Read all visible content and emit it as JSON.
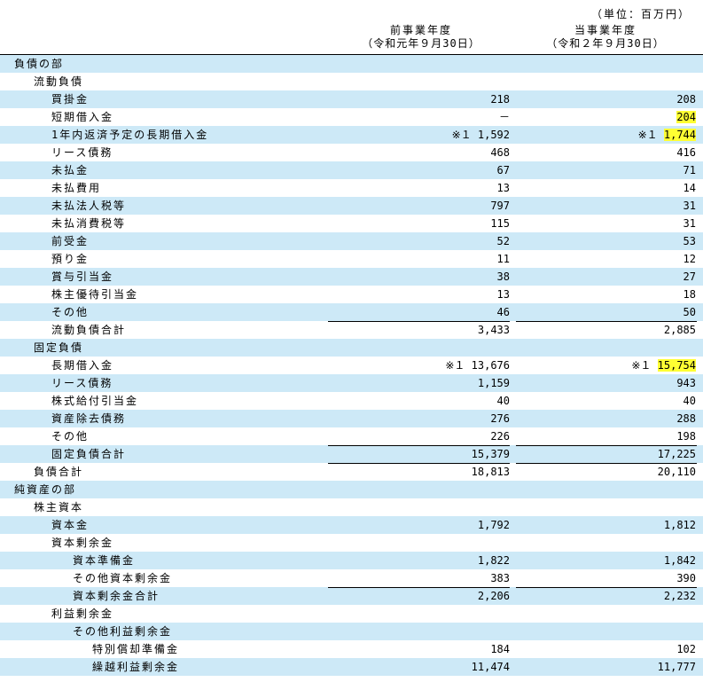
{
  "unit_label": "（単位：百万円）",
  "header": {
    "prev_label": "前事業年度",
    "prev_date": "（令和元年９月30日）",
    "curr_label": "当事業年度",
    "curr_date": "（令和２年９月30日）"
  },
  "rows": [
    {
      "label": "負債の部",
      "indent": 0,
      "prev": "",
      "curr": "",
      "alt": true,
      "line": false
    },
    {
      "label": "流動負債",
      "indent": 1,
      "prev": "",
      "curr": "",
      "alt": false,
      "line": false
    },
    {
      "label": "買掛金",
      "indent": 2,
      "prev": "218",
      "curr": "208",
      "alt": true,
      "line": false
    },
    {
      "label": "短期借入金",
      "indent": 2,
      "prev": "－",
      "curr": "204",
      "alt": false,
      "line": false,
      "highlight_curr": "204"
    },
    {
      "label": "1年内返済予定の長期借入金",
      "indent": 2,
      "prev": "※１ 1,592",
      "curr": "※１ 1,744",
      "alt": true,
      "line": false,
      "highlight_curr": "1,744"
    },
    {
      "label": "リース債務",
      "indent": 2,
      "prev": "468",
      "curr": "416",
      "alt": false,
      "line": false
    },
    {
      "label": "未払金",
      "indent": 2,
      "prev": "67",
      "curr": "71",
      "alt": true,
      "line": false
    },
    {
      "label": "未払費用",
      "indent": 2,
      "prev": "13",
      "curr": "14",
      "alt": false,
      "line": false
    },
    {
      "label": "未払法人税等",
      "indent": 2,
      "prev": "797",
      "curr": "31",
      "alt": true,
      "line": false
    },
    {
      "label": "未払消費税等",
      "indent": 2,
      "prev": "115",
      "curr": "31",
      "alt": false,
      "line": false
    },
    {
      "label": "前受金",
      "indent": 2,
      "prev": "52",
      "curr": "53",
      "alt": true,
      "line": false
    },
    {
      "label": "預り金",
      "indent": 2,
      "prev": "11",
      "curr": "12",
      "alt": false,
      "line": false
    },
    {
      "label": "賞与引当金",
      "indent": 2,
      "prev": "38",
      "curr": "27",
      "alt": true,
      "line": false
    },
    {
      "label": "株主優待引当金",
      "indent": 2,
      "prev": "13",
      "curr": "18",
      "alt": false,
      "line": false
    },
    {
      "label": "その他",
      "indent": 2,
      "prev": "46",
      "curr": "50",
      "alt": true,
      "line": false
    },
    {
      "label": "流動負債合計",
      "indent": 2,
      "prev": "3,433",
      "curr": "2,885",
      "alt": false,
      "line": true
    },
    {
      "label": "固定負債",
      "indent": 1,
      "prev": "",
      "curr": "",
      "alt": true,
      "line": false
    },
    {
      "label": "長期借入金",
      "indent": 2,
      "prev": "※１ 13,676",
      "curr": "※１ 15,754",
      "alt": false,
      "line": false,
      "highlight_curr": "15,754"
    },
    {
      "label": "リース債務",
      "indent": 2,
      "prev": "1,159",
      "curr": "943",
      "alt": true,
      "line": false
    },
    {
      "label": "株式給付引当金",
      "indent": 2,
      "prev": "40",
      "curr": "40",
      "alt": false,
      "line": false
    },
    {
      "label": "資産除去債務",
      "indent": 2,
      "prev": "276",
      "curr": "288",
      "alt": true,
      "line": false
    },
    {
      "label": "その他",
      "indent": 2,
      "prev": "226",
      "curr": "198",
      "alt": false,
      "line": false
    },
    {
      "label": "固定負債合計",
      "indent": 2,
      "prev": "15,379",
      "curr": "17,225",
      "alt": true,
      "line": true
    },
    {
      "label": "負債合計",
      "indent": 1,
      "prev": "18,813",
      "curr": "20,110",
      "alt": false,
      "line": true
    },
    {
      "label": "純資産の部",
      "indent": 0,
      "prev": "",
      "curr": "",
      "alt": true,
      "line": false
    },
    {
      "label": "株主資本",
      "indent": 1,
      "prev": "",
      "curr": "",
      "alt": false,
      "line": false
    },
    {
      "label": "資本金",
      "indent": 2,
      "prev": "1,792",
      "curr": "1,812",
      "alt": true,
      "line": false
    },
    {
      "label": "資本剰余金",
      "indent": 2,
      "prev": "",
      "curr": "",
      "alt": false,
      "line": false
    },
    {
      "label": "資本準備金",
      "indent": 3,
      "prev": "1,822",
      "curr": "1,842",
      "alt": true,
      "line": false
    },
    {
      "label": "その他資本剰余金",
      "indent": 3,
      "prev": "383",
      "curr": "390",
      "alt": false,
      "line": false
    },
    {
      "label": "資本剰余金合計",
      "indent": 3,
      "prev": "2,206",
      "curr": "2,232",
      "alt": true,
      "line": true
    },
    {
      "label": "利益剰余金",
      "indent": 2,
      "prev": "",
      "curr": "",
      "alt": false,
      "line": false
    },
    {
      "label": "その他利益剰余金",
      "indent": 3,
      "prev": "",
      "curr": "",
      "alt": true,
      "line": false
    },
    {
      "label": "特別償却準備金",
      "indent": 4,
      "prev": "184",
      "curr": "102",
      "alt": false,
      "line": false
    },
    {
      "label": "繰越利益剰余金",
      "indent": 4,
      "prev": "11,474",
      "curr": "11,777",
      "alt": true,
      "line": false
    }
  ]
}
